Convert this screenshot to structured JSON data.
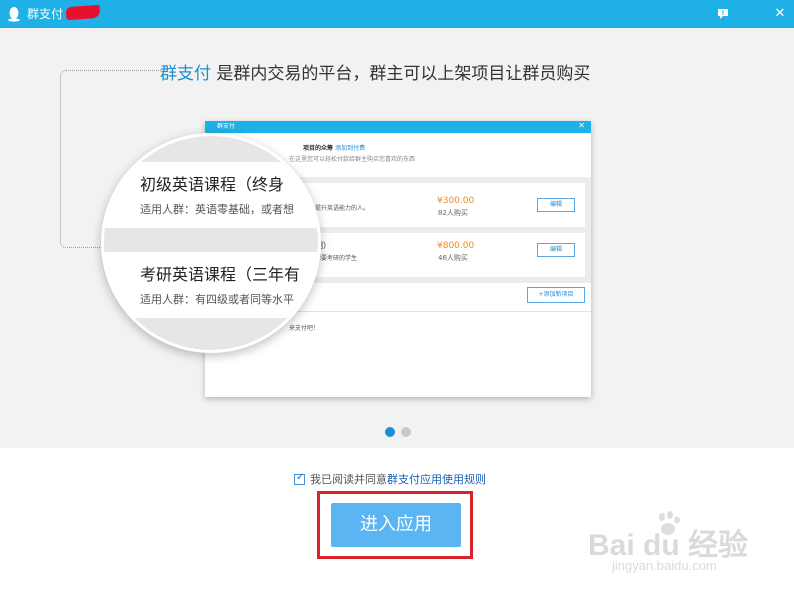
{
  "window": {
    "title": "群支付",
    "help_icon": "speech-bubble-icon",
    "close_icon": "close-icon"
  },
  "headline": {
    "highlight": "群支付",
    "rest": " 是群内交易的平台，群主可以上架项目让群员购买"
  },
  "mockup": {
    "title": "群支付",
    "header_line1": "项目的众筹",
    "header_link": "添加到付费",
    "header_line2": "在这里您可以轻松付款给群主购买您喜欢的东西",
    "items": [
      {
        "title_snippet": "",
        "desc_snippet": "提升英语能力的人。",
        "price": "¥300.00",
        "buyers": "82人购买",
        "edit_label": "编辑"
      },
      {
        "title_snippet": "期）",
        "desc_snippet": "需要考研的学生",
        "price": "¥800.00",
        "buyers": "46人购买",
        "edit_label": "编辑"
      }
    ],
    "add_button": "+添加新项目",
    "footer_note": "来支付吧！"
  },
  "magnifier": {
    "course1_title": "初级英语课程（终身",
    "course1_sub": "适用人群：英语零基础，或者想",
    "course2_title": "考研英语课程（三年有",
    "course2_sub": "适用人群：有四级或者同等水平"
  },
  "carousel": {
    "active_color": "#1b8fd1",
    "inactive_color": "#c8c8c8"
  },
  "agreement": {
    "checked": true,
    "text": "我已阅读并同意",
    "link": "群支付应用使用规则"
  },
  "enter_button": {
    "label": "进入应用"
  },
  "watermark": {
    "brand": "Bai du 经验",
    "url": "jingyan.baidu.com"
  },
  "colors": {
    "titlebar": "#1eb0e6",
    "accent": "#1b8fd1",
    "price": "#f08a1a",
    "button": "#5bb5f2",
    "highlight_box": "#d9232a"
  }
}
